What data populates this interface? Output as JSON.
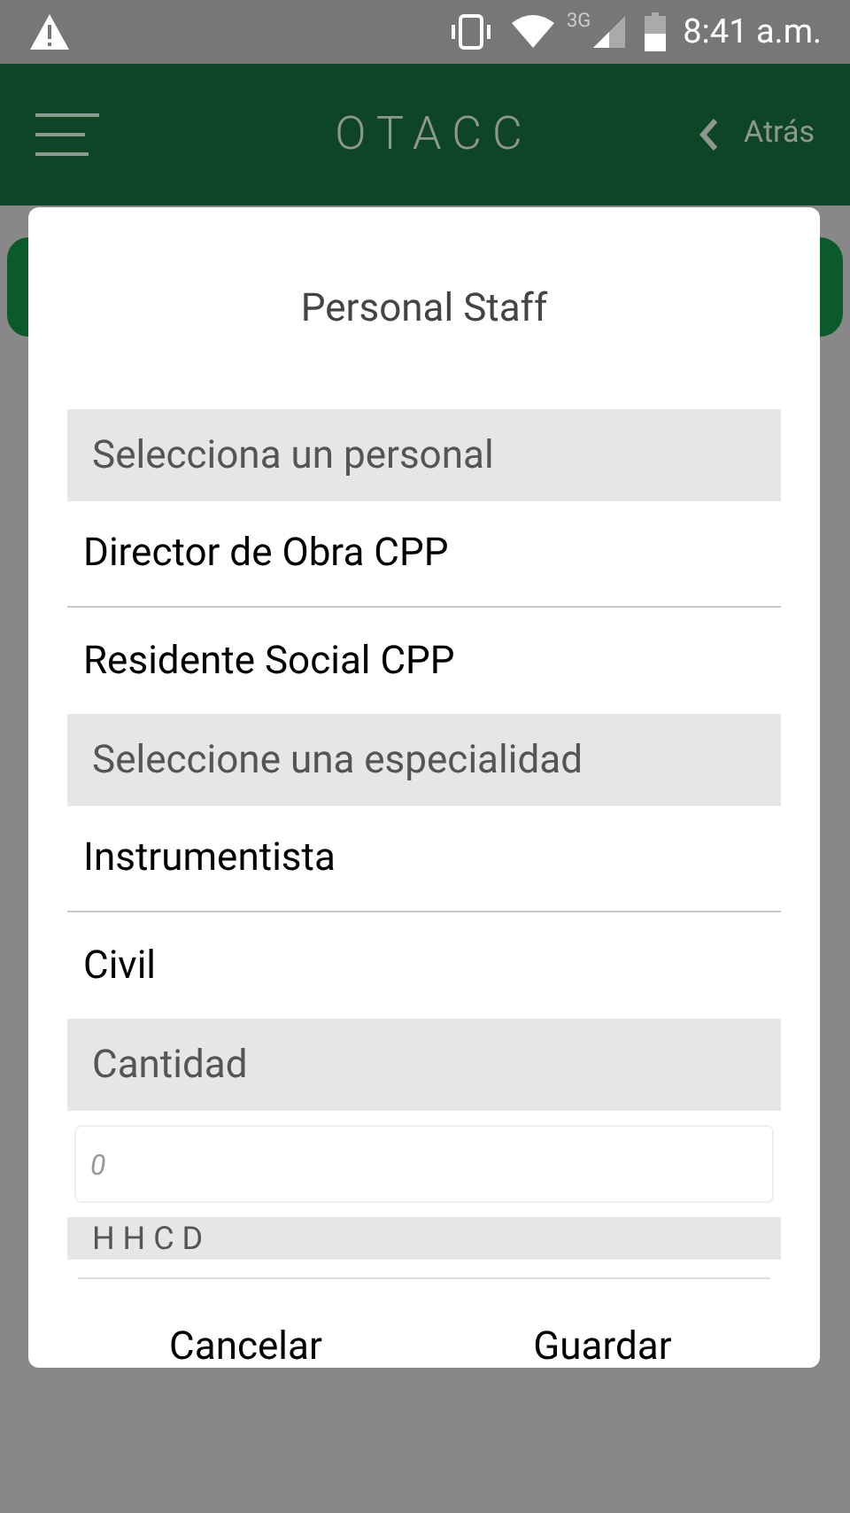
{
  "status_bar": {
    "network": "3G",
    "time": "8:41 a.m."
  },
  "header": {
    "logo": "OTACC",
    "back": "Atrás"
  },
  "dialog": {
    "title": "Personal Staff",
    "sections": [
      {
        "kind": "list",
        "heading": "Selecciona un personal",
        "options": [
          "Director de Obra CPP",
          "Residente Social CPP"
        ]
      },
      {
        "kind": "list",
        "heading": "Seleccione una especialidad",
        "options": [
          "Instrumentista",
          "Civil"
        ]
      },
      {
        "kind": "input",
        "heading": "Cantidad",
        "placeholder": "0"
      },
      {
        "kind": "cut",
        "heading": "H H C D"
      }
    ],
    "buttons": [
      "Cancelar",
      "Guardar"
    ]
  }
}
